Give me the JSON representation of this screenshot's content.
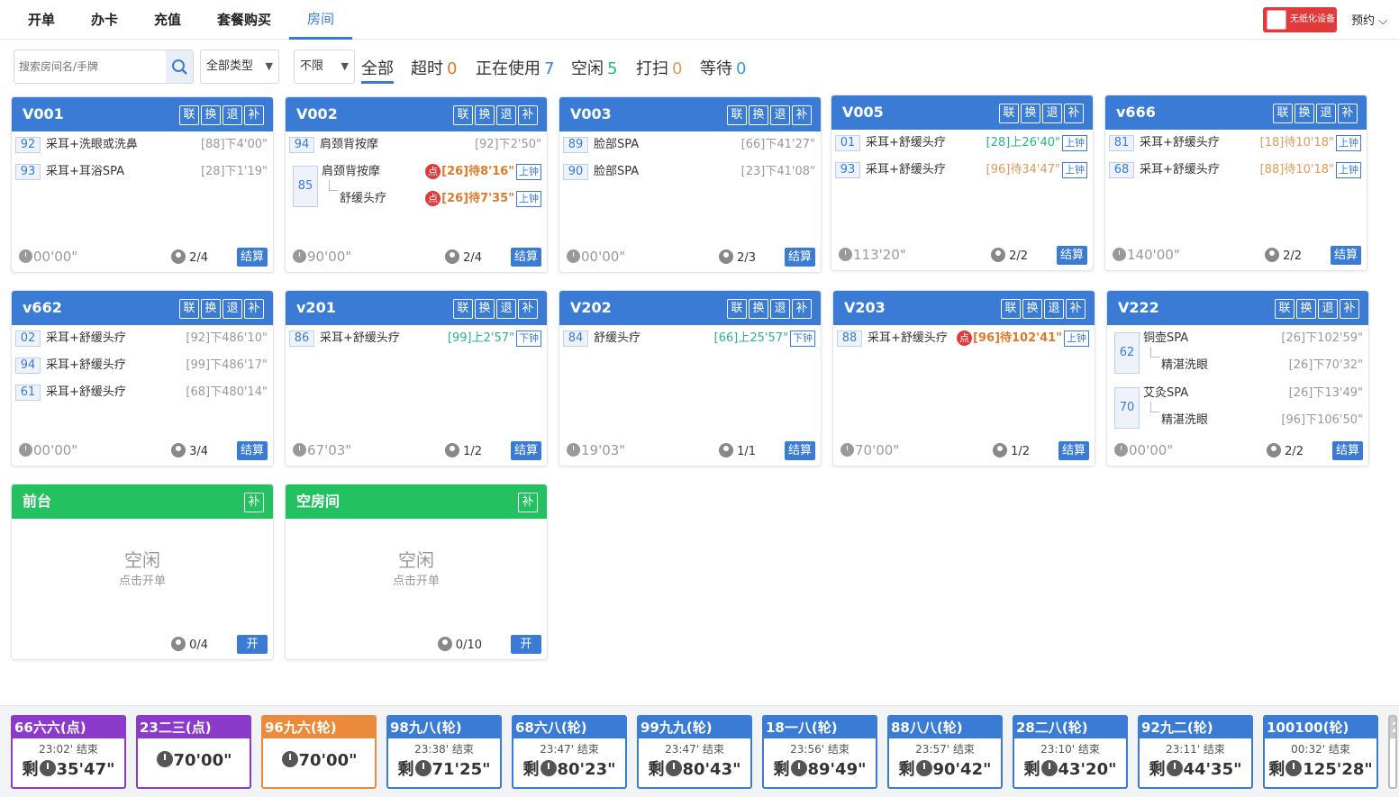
{
  "nav": {
    "tabs": [
      {
        "label": "开单"
      },
      {
        "label": "办卡"
      },
      {
        "label": "充值"
      },
      {
        "label": "套餐购买"
      },
      {
        "label": "房间"
      }
    ],
    "active": 4,
    "device_badge": "无纸化设备",
    "reserve": "预约 ⌵"
  },
  "toolbar": {
    "search_placeholder": "搜索房间名/手牌",
    "type_select": "全部类型",
    "limit_select": "不限",
    "filters": [
      {
        "label": "全部",
        "count": "",
        "color": "#333333"
      },
      {
        "label": "超时",
        "count": "0",
        "color": "#e07a2a"
      },
      {
        "label": "正在使用",
        "count": "7",
        "color": "#3a7bd5"
      },
      {
        "label": "空闲",
        "count": "5",
        "color": "#24b58a"
      },
      {
        "label": "打扫",
        "count": "0",
        "color": "#e09a5a"
      },
      {
        "label": "等待",
        "count": "0",
        "color": "#3a9bd5"
      }
    ]
  },
  "actions": [
    "联",
    "换",
    "退",
    "补"
  ],
  "settle_label": "结算",
  "open_label": "开",
  "supplement_label": "补",
  "clock_up": "上钟",
  "clock_down": "下钟",
  "point_mark": "点",
  "rooms": [
    {
      "name": "V001",
      "rows": [
        {
          "num": "92",
          "svc": "采耳+洗眼或洗鼻",
          "time": "[88]下4'00\""
        },
        {
          "num": "93",
          "svc": "采耳+耳浴SPA",
          "time": "[28]下1'19\""
        }
      ],
      "elapsed": "00'00\"",
      "cap": "2/4"
    },
    {
      "name": "V002",
      "rows": [
        {
          "num": "94",
          "svc": "肩颈背按摩",
          "time": "[92]下2'50\""
        }
      ],
      "group": {
        "num": "85",
        "a_svc": "肩颈背按摩",
        "a_time": "[26]待8'16\"",
        "b_svc": "舒缓头疗",
        "b_time": "[26]待7'35\""
      },
      "elapsed": "90'00\"",
      "cap": "2/4"
    },
    {
      "name": "V003",
      "rows": [
        {
          "num": "89",
          "svc": "脸部SPA",
          "time": "[66]下41'27\""
        },
        {
          "num": "90",
          "svc": "脸部SPA",
          "time": "[23]下41'08\""
        }
      ],
      "elapsed": "00'00\"",
      "cap": "2/3"
    },
    {
      "name": "V005",
      "rows": [
        {
          "num": "01",
          "svc": "采耳+舒缓头疗",
          "time": "[28]上26'40\""
        },
        {
          "num": "93",
          "svc": "采耳+舒缓头疗",
          "time": "[96]待34'47\""
        }
      ],
      "elapsed": "113'20\"",
      "cap": "2/2"
    },
    {
      "name": "v666",
      "rows": [
        {
          "num": "81",
          "svc": "采耳+舒缓头疗",
          "time": "[18]待10'18\""
        },
        {
          "num": "68",
          "svc": "采耳+舒缓头疗",
          "time": "[88]待10'18\""
        }
      ],
      "elapsed": "140'00\"",
      "cap": "2/2"
    },
    {
      "name": "v662",
      "rows": [
        {
          "num": "02",
          "svc": "采耳+舒缓头疗",
          "time": "[92]下486'10\""
        },
        {
          "num": "94",
          "svc": "采耳+舒缓头疗",
          "time": "[99]下486'17\""
        },
        {
          "num": "61",
          "svc": "采耳+舒缓头疗",
          "time": "[68]下480'14\""
        }
      ],
      "elapsed": "00'00\"",
      "cap": "3/4"
    },
    {
      "name": "v201",
      "rows": [
        {
          "num": "86",
          "svc": "采耳+舒缓头疗",
          "time": "[99]上2'57\""
        }
      ],
      "elapsed": "67'03\"",
      "cap": "1/2"
    },
    {
      "name": "V202",
      "rows": [
        {
          "num": "84",
          "svc": "舒缓头疗",
          "time": "[66]上25'57\""
        }
      ],
      "elapsed": "19'03\"",
      "cap": "1/1"
    },
    {
      "name": "V203",
      "rows": [
        {
          "num": "88",
          "svc": "采耳+舒缓头疗",
          "time": "[96]待102'41\""
        }
      ],
      "elapsed": "70'00\"",
      "cap": "1/2"
    },
    {
      "name": "V222",
      "groups": [
        {
          "num": "62",
          "a_svc": "铜壶SPA",
          "a_time": "[26]下102'59\"",
          "b_svc": "精湛洗眼",
          "b_time": "[26]下70'32\""
        },
        {
          "num": "70",
          "a_svc": "艾灸SPA",
          "a_time": "[26]下13'49\"",
          "b_svc": "精湛洗眼",
          "b_time": "[96]下106'50\""
        }
      ],
      "elapsed": "00'00\"",
      "cap": "2/2"
    },
    {
      "name": "前台",
      "idle": "空闲",
      "idle_sub": "点击开单",
      "cap": "0/4"
    },
    {
      "name": "空房间",
      "idle": "空闲",
      "idle_sub": "点击开单",
      "cap": "0/10"
    }
  ],
  "techs": [
    {
      "title": "66六六(点)",
      "end": "23:02' 结束",
      "remain_prefix": "剩",
      "remain": "35'47\"",
      "theme": "#8b3ac9"
    },
    {
      "title": "23二三(点)",
      "end": "",
      "remain_prefix": "",
      "remain": "70'00\"",
      "theme": "#8b3ac9"
    },
    {
      "title": "96九六(轮)",
      "end": "",
      "remain_prefix": "",
      "remain": "70'00\"",
      "theme": "#ec8a3c"
    },
    {
      "title": "98九八(轮)",
      "end": "23:38' 结束",
      "remain_prefix": "剩",
      "remain": "71'25\"",
      "theme": "#3a7bd5"
    },
    {
      "title": "68六八(轮)",
      "end": "23:47' 结束",
      "remain_prefix": "剩",
      "remain": "80'23\"",
      "theme": "#3a7bd5"
    },
    {
      "title": "99九九(轮)",
      "end": "23:47' 结束",
      "remain_prefix": "剩",
      "remain": "80'43\"",
      "theme": "#3a7bd5"
    },
    {
      "title": "18一八(轮)",
      "end": "23:56' 结束",
      "remain_prefix": "剩",
      "remain": "89'49\"",
      "theme": "#3a7bd5"
    },
    {
      "title": "88八八(轮)",
      "end": "23:57' 结束",
      "remain_prefix": "剩",
      "remain": "90'42\"",
      "theme": "#3a7bd5"
    },
    {
      "title": "28二八(轮)",
      "end": "23:10' 结束",
      "remain_prefix": "剩",
      "remain": "43'20\"",
      "theme": "#3a7bd5"
    },
    {
      "title": "92九二(轮)",
      "end": "23:11' 结束",
      "remain_prefix": "剩",
      "remain": "44'35\"",
      "theme": "#3a7bd5"
    },
    {
      "title": "100100(轮)",
      "end": "00:32' 结束",
      "remain_prefix": "剩",
      "remain": "125'28\"",
      "theme": "#3a7bd5"
    }
  ],
  "tech_partial": "2"
}
